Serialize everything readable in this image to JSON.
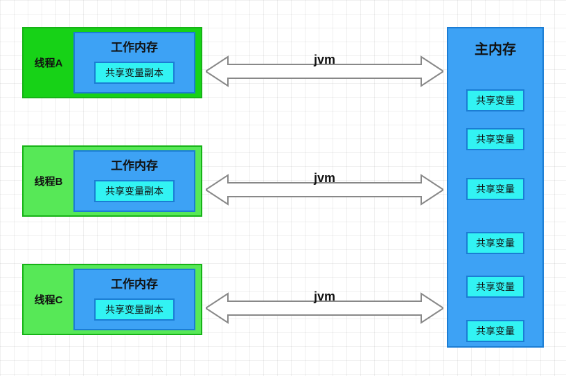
{
  "threads": [
    {
      "label": "线程A",
      "workmem_title": "工作内存",
      "copy_label": "共享变量副本",
      "color": "#17d217"
    },
    {
      "label": "线程B",
      "workmem_title": "工作内存",
      "copy_label": "共享变量副本",
      "color": "#57e857"
    },
    {
      "label": "线程C",
      "workmem_title": "工作内存",
      "copy_label": "共享变量副本",
      "color": "#57e857"
    }
  ],
  "arrow_label": "jvm",
  "main_memory": {
    "title": "主内存",
    "items": [
      "共享变量",
      "共享变量",
      "共享变量",
      "共享变量",
      "共享变量",
      "共享变量"
    ]
  },
  "chart_data": {
    "type": "diagram",
    "description": "JVM memory model: three threads each with a working-memory copy of shared variables, communicating via jvm with main memory holding six shared variables",
    "threads": [
      "线程A",
      "线程B",
      "线程C"
    ],
    "thread_workmem": "工作内存",
    "thread_copy": "共享变量副本",
    "connector": "jvm",
    "main_memory": "主内存",
    "shared_count": 6
  }
}
